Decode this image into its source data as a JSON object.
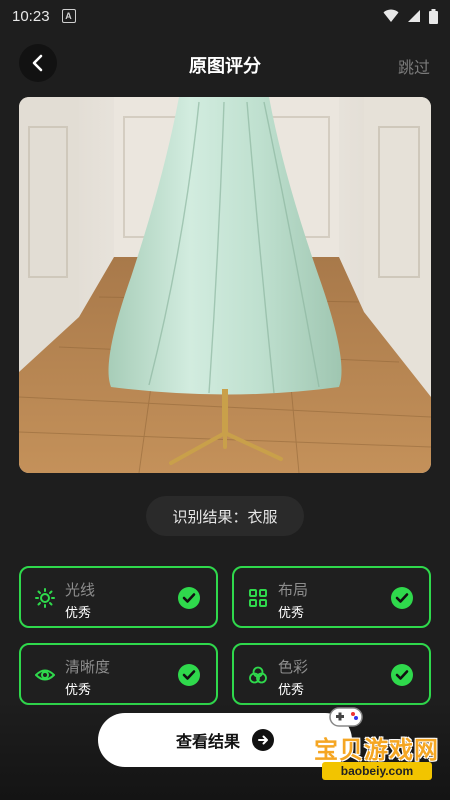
{
  "status_bar": {
    "time": "10:23",
    "notification_glyph": "A",
    "icons": [
      "wifi-icon",
      "signal-icon",
      "battery-icon"
    ]
  },
  "header": {
    "back_icon": "chevron-left-icon",
    "title": "原图评分",
    "skip_label": "跳过"
  },
  "photo": {
    "subject": "mint green pleated midi skirt on brass mannequin stand"
  },
  "result": {
    "label": "识别结果：衣服"
  },
  "cards": [
    {
      "icon": "sun-icon",
      "title": "光线",
      "value": "优秀"
    },
    {
      "icon": "layout-grid-icon",
      "title": "布局",
      "value": "优秀"
    },
    {
      "icon": "eye-icon",
      "title": "清晰度",
      "value": "优秀"
    },
    {
      "icon": "color-circles-icon",
      "title": "色彩",
      "value": "优秀"
    }
  ],
  "cta": {
    "label": "查看结果",
    "icon": "arrow-right-icon"
  },
  "watermark": {
    "text": "宝贝游戏网",
    "url": "baobeiy.com"
  },
  "colors": {
    "accent": "#2fd94c",
    "background": "#1e1e1e",
    "cta_bg": "#ffffff"
  }
}
